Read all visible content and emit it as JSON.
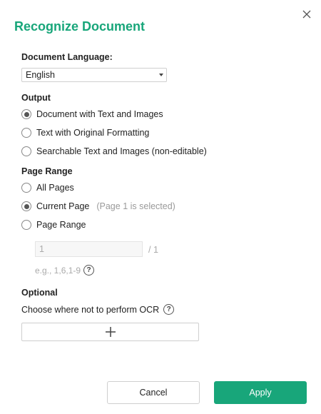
{
  "dialog": {
    "title": "Recognize Document",
    "close_icon": "close-icon"
  },
  "language": {
    "label": "Document Language:",
    "selected": "English"
  },
  "output": {
    "label": "Output",
    "options": [
      {
        "label": "Document with Text and Images",
        "checked": true
      },
      {
        "label": "Text with Original Formatting",
        "checked": false
      },
      {
        "label": "Searchable Text and Images (non-editable)",
        "checked": false
      }
    ]
  },
  "page_range": {
    "label": "Page Range",
    "options": [
      {
        "label": "All Pages",
        "checked": false
      },
      {
        "label": "Current Page",
        "hint": "(Page 1 is selected)",
        "checked": true
      },
      {
        "label": "Page Range",
        "checked": false
      }
    ],
    "input_value": "1",
    "total": "/ 1",
    "example": "e.g., 1,6,1-9",
    "help_icon": "question-icon"
  },
  "optional": {
    "label": "Optional",
    "description": "Choose where not to perform OCR",
    "help_icon": "question-icon",
    "add_icon": "plus-icon"
  },
  "buttons": {
    "cancel": "Cancel",
    "apply": "Apply"
  },
  "colors": {
    "accent": "#18a67a"
  }
}
